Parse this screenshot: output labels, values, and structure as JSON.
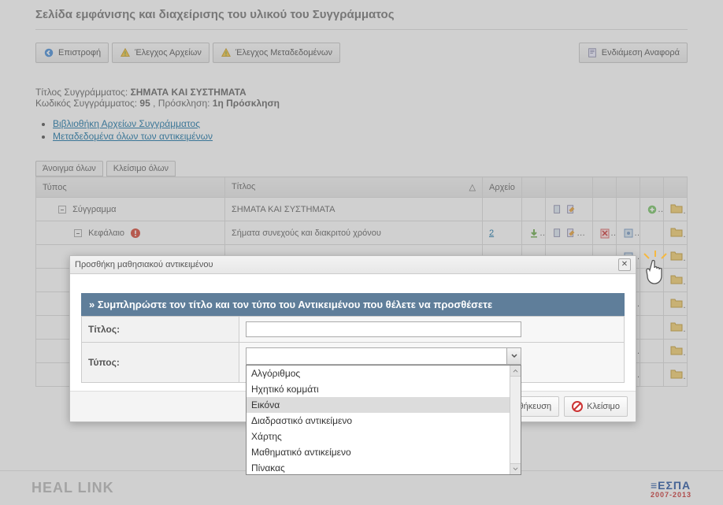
{
  "page": {
    "title": "Σελίδα εμφάνισης και διαχείρισης του υλικού του Συγγράμματος"
  },
  "toolbar": {
    "back": "Επιστροφή",
    "check_files": "Έλεγχος Αρχείων",
    "check_metadata": "Έλεγχος Μεταδεδομένων",
    "interim_report": "Ενδιάμεση Αναφορά"
  },
  "meta": {
    "title_label": "Τίτλος Συγγράμματος:",
    "title_value": "ΣΗΜΑΤΑ ΚΑΙ ΣΥΣΤΗΜΑΤΑ",
    "code_label": "Κωδικός Συγγράμματος: ",
    "code_value": "95",
    "call_label": ", Πρόσκληση: ",
    "call_value": "1η Πρόσκληση"
  },
  "links": {
    "library": "Βιβλιοθήκη Αρχείων Συγγράμματος",
    "metadata_all": "Μεταδεδομένα όλων των αντικειμένων"
  },
  "tree_controls": {
    "open_all": "Άνοιγμα όλων",
    "close_all": "Κλείσιμο όλων"
  },
  "table": {
    "headers": {
      "type": "Τύπος",
      "title": "Τίτλος",
      "file": "Αρχείο"
    },
    "rows": [
      {
        "type": "Σύγγραμμα",
        "title": "ΣΗΜΑΤΑ ΚΑΙ ΣΥΣΤΗΜΑΤΑ",
        "file": ""
      },
      {
        "type": "Κεφάλαιο",
        "title": "Σήματα συνεχούς και διακριτού χρόνου",
        "file": "2"
      }
    ]
  },
  "dialog": {
    "title": "Προσθήκη μαθησιακού αντικειμένου",
    "section_header": "» Συμπληρώστε τον τίτλο και τον τύπο του Αντικειμένου που θέλετε να προσθέσετε",
    "fields": {
      "title_label": "Τίτλος:",
      "type_label": "Τύπος:"
    },
    "options": [
      "Αλγόριθμος",
      "Ηχητικό κομμάτι",
      "Εικόνα",
      "Διαδραστικό αντικείμενο",
      "Χάρτης",
      "Μαθηματικό αντικείμενο",
      "Πίνακας"
    ],
    "buttons": {
      "save": "Αποθήκευση",
      "close": "Κλείσιμο"
    }
  },
  "footer": {
    "left": "HEAL LINK",
    "right_main": "≡ΕΣΠΑ",
    "right_sub": "2007-2013"
  }
}
